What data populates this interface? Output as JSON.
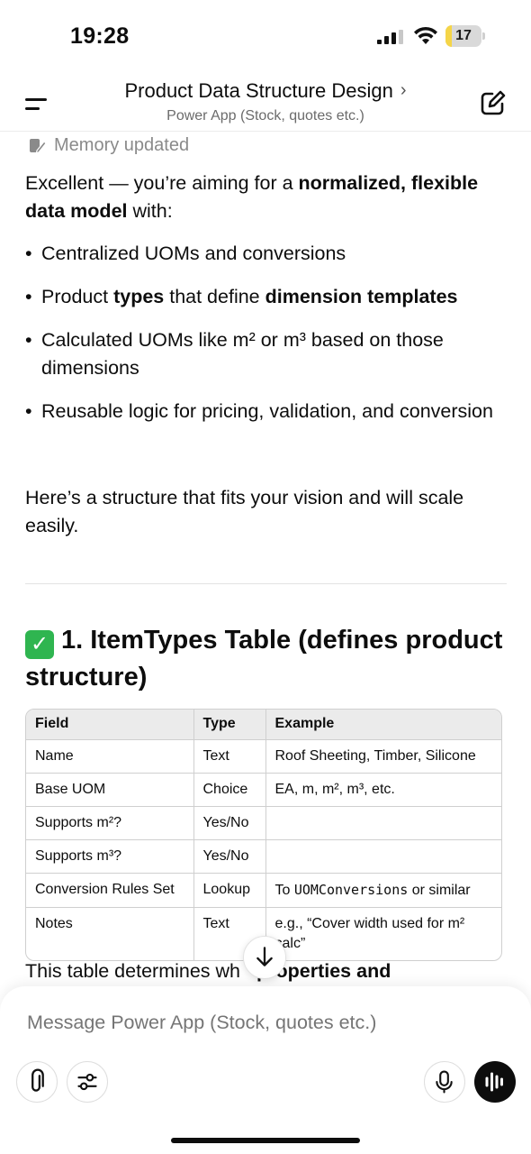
{
  "status_bar": {
    "time": "19:28",
    "battery_level": "17",
    "battery_percent": 17
  },
  "header": {
    "title": "Product Data Structure Design",
    "chevron": "›",
    "subtitle": "Power App (Stock, quotes etc.)"
  },
  "message": {
    "memory_text": "Memory updated",
    "intro_a": "Excellent — you’re aiming for a ",
    "intro_b": "normalized, flexible data model",
    "intro_c": " with:",
    "bullets": {
      "b1": "Centralized UOMs and conversions",
      "b2_a": "Product ",
      "b2_b": "types",
      "b2_c": " that define ",
      "b2_d": "dimension templates",
      "b3": "Calculated UOMs like m² or m³ based on those dimensions",
      "b4": "Reusable logic for pricing, validation, and conversion"
    },
    "closing": "Here’s a structure that fits your vision and will scale easily.",
    "section_check": "✓",
    "section_title": "1. ItemTypes Table (defines product structure)",
    "table": {
      "headers": [
        "Field",
        "Type",
        "Example"
      ],
      "rows": [
        [
          "Name",
          "Text",
          "Roof Sheeting, Timber, Silicone"
        ],
        [
          "Base UOM",
          "Choice",
          "EA, m, m², m³, etc."
        ],
        [
          "Supports m²?",
          "Yes/No",
          ""
        ],
        [
          "Supports m³?",
          "Yes/No",
          ""
        ],
        [
          "Conversion Rules Set",
          "Lookup",
          ""
        ],
        [
          "Notes",
          "Text",
          "e.g., “Cover width used for m² calc”"
        ]
      ],
      "row5_example_a": "To ",
      "row5_example_code": "UOMConversions",
      "row5_example_b": " or similar"
    },
    "trailing_a": "This table determines wh",
    "trailing_b": "properties and"
  },
  "composer": {
    "placeholder": "Message Power App (Stock, quotes etc.)"
  },
  "icons": {
    "memory": "memory-pen-icon",
    "menu": "menu-icon",
    "compose": "compose-icon",
    "scroll": "arrow-down-icon",
    "attach": "paperclip-icon",
    "tools": "sliders-icon",
    "mic": "microphone-icon",
    "voice": "voice-wave-icon"
  }
}
